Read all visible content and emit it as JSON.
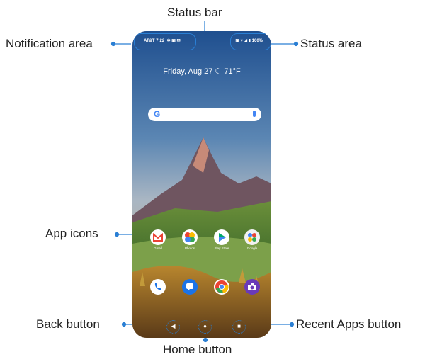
{
  "callouts": {
    "status_bar": "Status bar",
    "notification_area": "Notification area",
    "status_area": "Status area",
    "app_icons": "App icons",
    "back_button": "Back button",
    "home_button": "Home button",
    "recent_apps_button": "Recent Apps button"
  },
  "phone": {
    "carrier_time": "AT&T 7:22",
    "battery": "100%",
    "date_weather": "Friday, Aug 27 ☾ 71°F",
    "search_logo": "G",
    "apps_row1": [
      {
        "label": "Gmail",
        "icon": "gmail-icon",
        "color": "#ffffff"
      },
      {
        "label": "Photos",
        "icon": "photos-icon",
        "color": "#ffffff"
      },
      {
        "label": "Play Store",
        "icon": "play-store-icon",
        "color": "#ffffff"
      },
      {
        "label": "Google",
        "icon": "google-folder-icon",
        "color": "#f1f1f1"
      }
    ],
    "dock": [
      {
        "icon": "phone-icon",
        "color": "#1a73e8"
      },
      {
        "icon": "messages-icon",
        "color": "#1a73e8"
      },
      {
        "icon": "chrome-icon",
        "color": "#ffffff"
      },
      {
        "icon": "camera-icon",
        "color": "#6a3ab8"
      }
    ],
    "nav": {
      "back": "◀",
      "home": "●",
      "recent": "■"
    }
  },
  "accent": "#2a7fd4"
}
